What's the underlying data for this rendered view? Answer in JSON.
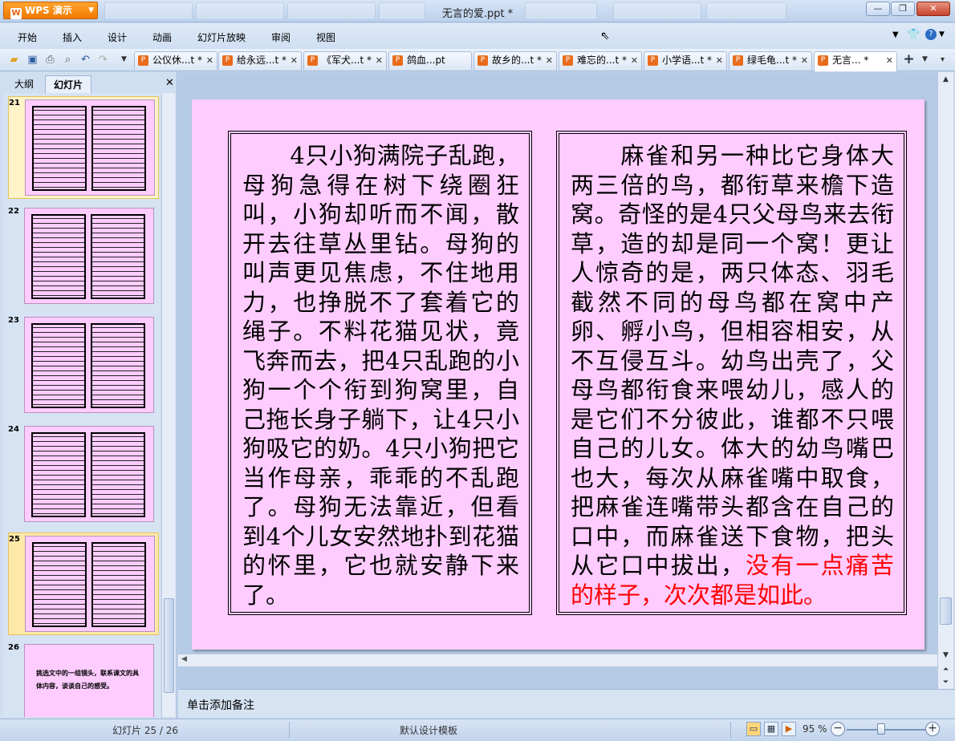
{
  "window": {
    "app_name": "WPS 演示",
    "doc_title": "无言的爱.ppt *",
    "controls": {
      "minimize": "—",
      "maximize": "❐",
      "close": "✕"
    }
  },
  "menu": [
    "开始",
    "插入",
    "设计",
    "动画",
    "幻灯片放映",
    "审阅",
    "视图"
  ],
  "doc_tabs": [
    {
      "label": "公仪休...t *"
    },
    {
      "label": "给永远...t *"
    },
    {
      "label": "《军犬...t *"
    },
    {
      "label": "鸽血...pt"
    },
    {
      "label": "故乡的...t *"
    },
    {
      "label": "难忘的...t *"
    },
    {
      "label": "小学语...t *"
    },
    {
      "label": "绿毛龟...t *"
    },
    {
      "label": "无言... *"
    }
  ],
  "left_pane": {
    "tabs": [
      "大纲",
      "幻灯片"
    ],
    "active_tab": "幻灯片",
    "slides": [
      "21",
      "22",
      "23",
      "24",
      "25",
      "26"
    ],
    "selected_slide": "25",
    "slide26_text": "挑选文中的一组镜头，联系课文的具体内容，谈谈自己的感受。"
  },
  "slide": {
    "left_text": "　　4只小狗满院子乱跑，母狗急得在树下绕圈狂叫，小狗却听而不闻，散开去往草丛里钻。母狗的叫声更见焦虑，不住地用力，也挣脱不了套着它的绳子。不料花猫见状，竟飞奔而去，把4只乱跑的小狗一个个衔到狗窝里，自己拖长身子躺下，让4只小狗吸它的奶。4只小狗把它当作母亲，乖乖的不乱跑了。母狗无法靠近，但看到4个儿女安然地扑到花猫的怀里，它也就安静下来了。",
    "right_text": "　　麻雀和另一种比它身体大两三倍的鸟，都衔草来檐下造窝。奇怪的是4只父母鸟来去衔草，造的却是同一个窝！更让人惊奇的是，两只体态、羽毛截然不同的母鸟都在窝中产卵、孵小鸟，但相容相安，从不互侵互斗。幼鸟出壳了，父母鸟都衔食来喂幼儿，感人的是它们不分彼此，谁都不只喂自己的儿女。体大的幼鸟嘴巴也大，每次从麻雀嘴中取食，把麻雀连嘴带头都含在自己的口中，而麻雀送下食物，把头从它口中拔出，",
    "right_text_red": "没有一点痛苦的样子，次次都是如此。",
    "highlight_color": "#ff0000",
    "background_color": "#ffccff"
  },
  "notes_placeholder": "单击添加备注",
  "status": {
    "slide_counter": "幻灯片 25 / 26",
    "template": "默认设计模板",
    "zoom": "95 %"
  }
}
